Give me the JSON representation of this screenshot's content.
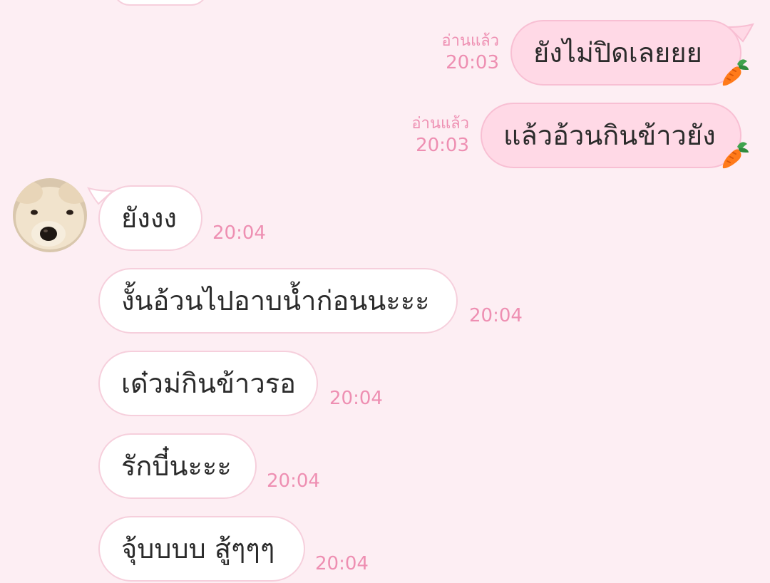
{
  "colors": {
    "background": "#fdeef3",
    "outgoing_bubble": "#ffd9e6",
    "incoming_bubble": "#ffffff",
    "meta_text": "#ee8fb2"
  },
  "outgoing": [
    {
      "text": "ยังไม่ปิดเลยยย",
      "read": "อ่านแล้ว",
      "time": "20:03",
      "sticker": "carrot-icon"
    },
    {
      "text": "แล้วอ้วนกินข้าวยัง",
      "read": "อ่านแล้ว",
      "time": "20:03",
      "sticker": "carrot-icon"
    }
  ],
  "incoming": [
    {
      "text": "ยังงง",
      "time": "20:04"
    },
    {
      "text": "งั้นอ้วนไปอาบน้ำก่อนนะะะ",
      "time": "20:04"
    },
    {
      "text": "เด๋วม่กินข้าวรอ",
      "time": "20:04"
    },
    {
      "text": "รักบี๋นะะะ",
      "time": "20:04"
    },
    {
      "text": "จุ้บบบบ สู้ๆๆๆ",
      "time": "20:04"
    }
  ],
  "contact": {
    "avatar": "dog-avatar-icon"
  }
}
